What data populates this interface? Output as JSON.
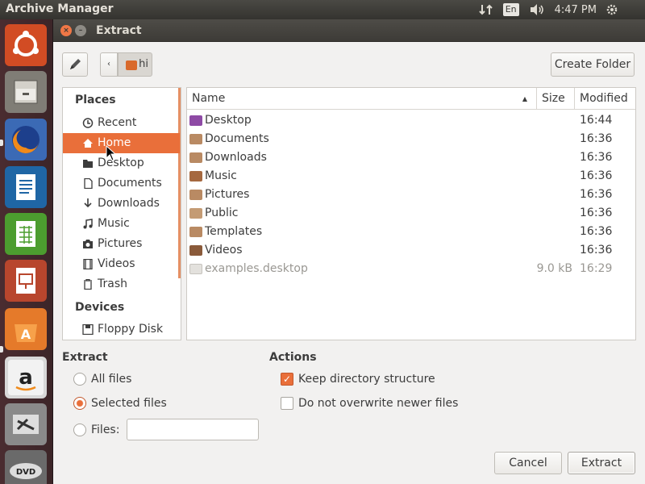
{
  "top_panel": {
    "app_title": "Archive Manager",
    "lang": "En",
    "clock": "4:47 PM"
  },
  "dialog": {
    "title": "Extract",
    "path_segment": "hi",
    "create_folder": "Create Folder",
    "places_heading": "Places",
    "devices_heading": "Devices",
    "places": [
      {
        "label": "Recent",
        "icon": "clock-icon"
      },
      {
        "label": "Home",
        "icon": "home-icon",
        "selected": true
      },
      {
        "label": "Desktop",
        "icon": "folder-icon"
      },
      {
        "label": "Documents",
        "icon": "document-icon"
      },
      {
        "label": "Downloads",
        "icon": "download-icon"
      },
      {
        "label": "Music",
        "icon": "music-icon"
      },
      {
        "label": "Pictures",
        "icon": "camera-icon"
      },
      {
        "label": "Videos",
        "icon": "film-icon"
      },
      {
        "label": "Trash",
        "icon": "trash-icon"
      }
    ],
    "devices": [
      {
        "label": "Floppy Disk",
        "icon": "floppy-icon"
      }
    ],
    "columns": {
      "name": "Name",
      "size": "Size",
      "modified": "Modified"
    },
    "files": [
      {
        "name": "Desktop",
        "size": "",
        "modified": "16:44",
        "icon": "folder-desktop-icon"
      },
      {
        "name": "Documents",
        "size": "",
        "modified": "16:36",
        "icon": "folder-documents-icon"
      },
      {
        "name": "Downloads",
        "size": "",
        "modified": "16:36",
        "icon": "folder-downloads-icon"
      },
      {
        "name": "Music",
        "size": "",
        "modified": "16:36",
        "icon": "folder-music-icon"
      },
      {
        "name": "Pictures",
        "size": "",
        "modified": "16:36",
        "icon": "folder-pictures-icon"
      },
      {
        "name": "Public",
        "size": "",
        "modified": "16:36",
        "icon": "folder-public-icon"
      },
      {
        "name": "Templates",
        "size": "",
        "modified": "16:36",
        "icon": "folder-templates-icon"
      },
      {
        "name": "Videos",
        "size": "",
        "modified": "16:36",
        "icon": "folder-videos-icon"
      },
      {
        "name": "examples.desktop",
        "size": "9.0 kB",
        "modified": "16:29",
        "icon": "file-icon",
        "dim": true
      }
    ],
    "extract_section": {
      "title": "Extract",
      "all_files": "All files",
      "selected_files": "Selected files",
      "files_label": "Files:",
      "files_value": "",
      "selected_option": "Selected files"
    },
    "actions_section": {
      "title": "Actions",
      "keep_structure": "Keep directory structure",
      "keep_structure_checked": true,
      "no_overwrite": "Do not overwrite newer files",
      "no_overwrite_checked": false
    },
    "cancel": "Cancel",
    "extract": "Extract"
  },
  "colors": {
    "accent": "#e96f3a",
    "panel": "#3b3a36",
    "launcher": "#4a2c30"
  }
}
